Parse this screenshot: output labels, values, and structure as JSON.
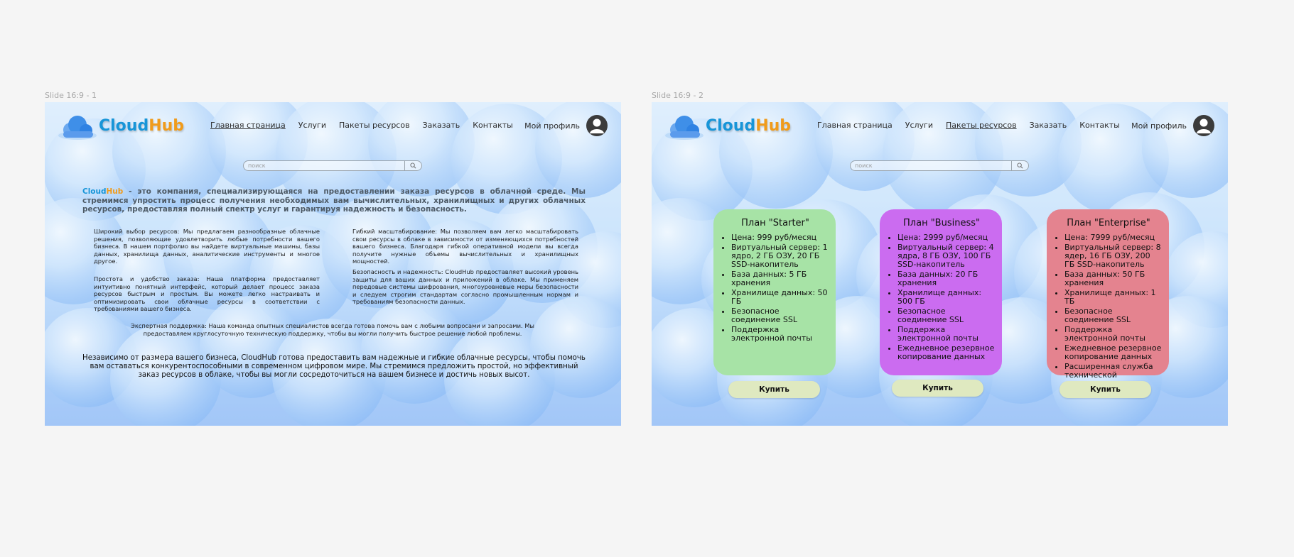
{
  "slides": [
    {
      "frame_label": "Slide 16:9 - 1",
      "logo": {
        "part1": "Cloud",
        "part2": "Hub"
      },
      "nav": [
        {
          "label": "Главная страница",
          "active": true
        },
        {
          "label": "Услуги",
          "active": false
        },
        {
          "label": "Пакеты ресурсов",
          "active": false
        },
        {
          "label": "Заказать",
          "active": false
        },
        {
          "label": "Контакты",
          "active": false
        }
      ],
      "profile_label": "Мой профиль",
      "search_placeholder": "поиск",
      "intro_brand": {
        "part1": "Cloud",
        "part2": "Hub"
      },
      "intro_text": " - это компания, специализирующаяся на предоставлении заказа ресурсов в облачной среде. Мы стремимся упростить процесс получения необходимых вам вычислительных, хранилищных и других облачных ресурсов, предоставляя полный спектр услуг и гарантируя надежность и безопасность.",
      "features": [
        "Широкий выбор ресурсов: Мы предлагаем разнообразные облачные решения, позволяющие удовлетворить любые потребности вашего бизнеса. В нашем портфолио вы найдете виртуальные машины, базы данных, хранилища данных, аналитические инструменты и многое другое.",
        "Гибкий масштабирование: Мы позволяем вам легко масштабировать свои ресурсы в облаке в зависимости от изменяющихся потребностей вашего бизнеса. Благодаря гибкой оперативной модели вы всегда получите нужные объемы вычислительных и хранилищных мощностей.",
        "Простота и удобство заказа: Наша платформа предоставляет интуитивно понятный интерфейс, который делает процесс заказа ресурсов быстрым и простым. Вы можете легко настраивать и оптимизировать свои облачные ресурсы в соответствии с требованиями вашего бизнеса.",
        "Безопасность и надежность: CloudHub предоставляет высокий уровень защиты для ваших данных и приложений в облаке. Мы применяем передовые системы шифрования, многоуровневые меры безопасности и следуем строгим стандартам согласно промышленным нормам и требованиям безопасности данных."
      ],
      "support_text": "Экспертная поддержка: Наша команда опытных специалистов всегда готова помочь вам с любыми вопросами и запросами. Мы предоставляем круглосуточную техническую поддержку, чтобы вы могли получить быстрое решение любой проблемы.",
      "closing": {
        "before": "Независимо от размера вашего бизнеса, ",
        "brand": "CloudHub",
        "after": " готова предоставить вам надежные и гибкие облачные ресурсы, чтобы помочь вам оставаться конкурентоспособными в современном цифровом мире. Мы стремимся предложить простой, но эффективный заказ ресурсов в облаке, чтобы вы могли сосредоточиться на вашем бизнесе и достичь новых высот."
      }
    },
    {
      "frame_label": "Slide 16:9 - 2",
      "logo": {
        "part1": "Cloud",
        "part2": "Hub"
      },
      "nav": [
        {
          "label": "Главная страница",
          "active": false
        },
        {
          "label": "Услуги",
          "active": false
        },
        {
          "label": "Пакеты ресурсов",
          "active": true
        },
        {
          "label": "Заказать",
          "active": false
        },
        {
          "label": "Контакты",
          "active": false
        }
      ],
      "profile_label": "Мой профиль",
      "search_placeholder": "поиск",
      "plans": [
        {
          "title": "План \"Starter\"",
          "color": "#a7e3a6",
          "features": [
            "Цена: 999 руб/месяц",
            "Виртуальный сервер: 1 ядро, 2 ГБ ОЗУ, 20 ГБ SSD-накопитель",
            "База данных: 5 ГБ хранения",
            "Хранилище данных: 50 ГБ",
            "Безопасное соединение SSL",
            "Поддержка электронной почты"
          ],
          "button": "Купить"
        },
        {
          "title": "План \"Business\"",
          "color": "#cb6cf0",
          "features": [
            "Цена: 2999 руб/месяц",
            "Виртуальный сервер: 4 ядра, 8 ГБ ОЗУ, 100 ГБ SSD-накопитель",
            "База данных: 20 ГБ хранения",
            "Хранилище данных: 500 ГБ",
            "Безопасное соединение SSL",
            "Поддержка электронной почты",
            "Ежедневное резервное копирование данных"
          ],
          "button": "Купить"
        },
        {
          "title": "План \"Enterprise\"",
          "color": "#e4838f",
          "features": [
            "Цена: 7999 руб/месяц",
            "Виртуальный сервер: 8 ядер, 16 ГБ ОЗУ, 200 ГБ SSD-накопитель",
            "База данных: 50 ГБ хранения",
            "Хранилище данных: 1 ТБ",
            "Безопасное соединение SSL",
            "Поддержка электронной почты",
            "Ежедневное резервное копирование данных",
            "Расширенная служба технической поддержки"
          ],
          "button": "Купить"
        }
      ]
    }
  ]
}
